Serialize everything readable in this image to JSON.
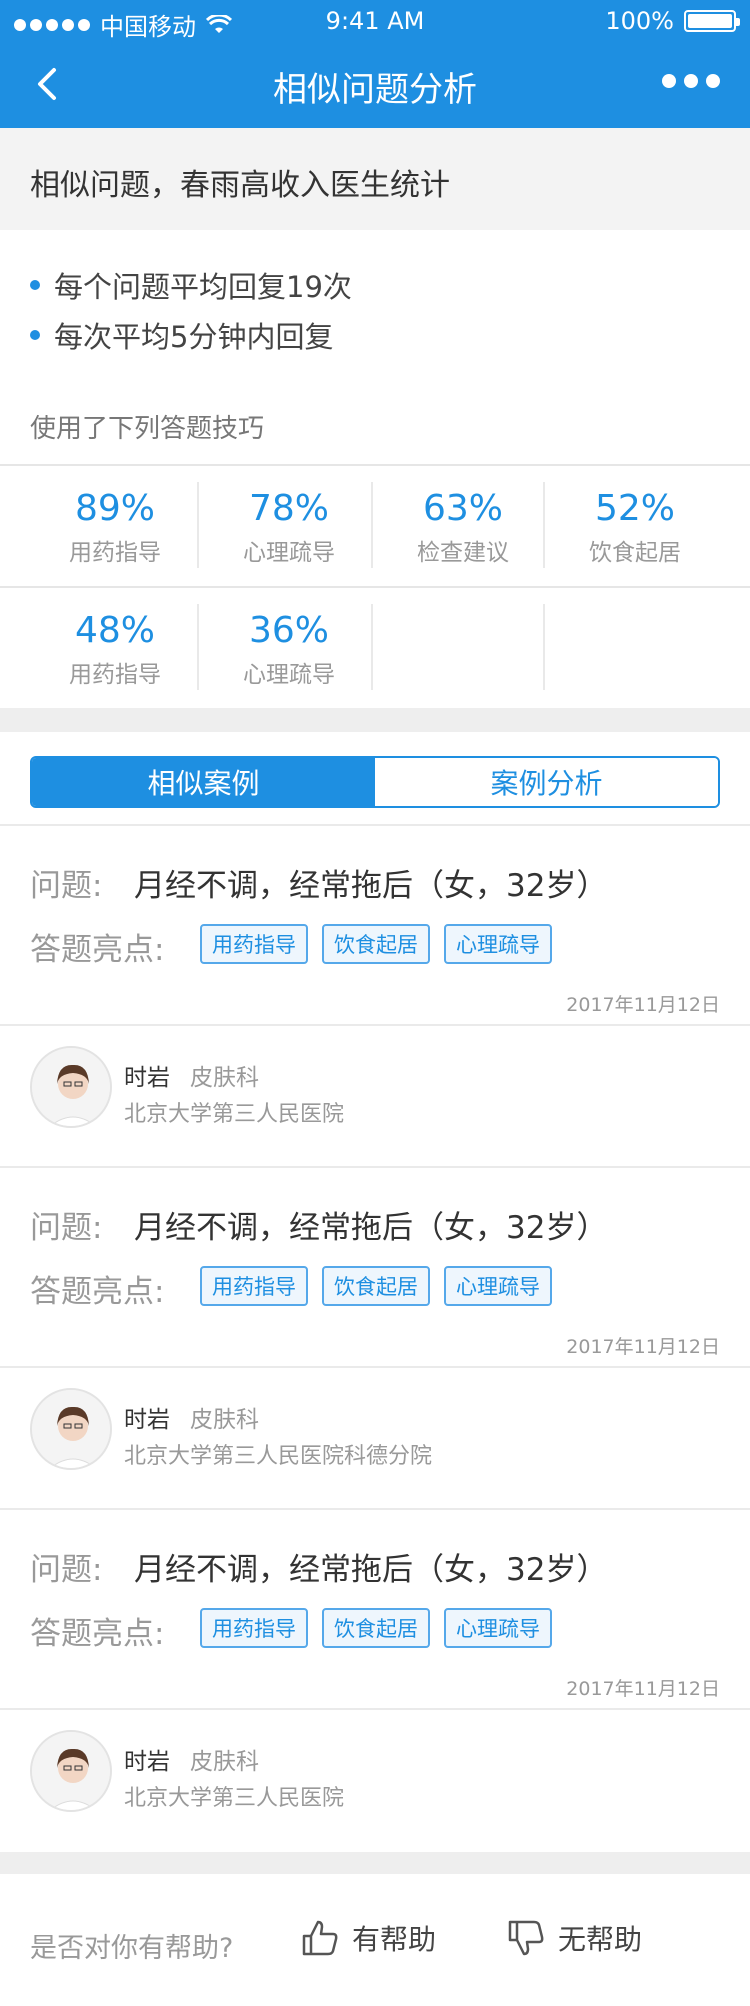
{
  "status_bar": {
    "carrier": "中国移动",
    "time": "9:41 AM",
    "battery": "100%"
  },
  "nav": {
    "title": "相似问题分析",
    "back_icon": "chevron-left-icon",
    "more_icon": "more-dots-icon"
  },
  "header": {
    "text": "相似问题，春雨高收入医生统计"
  },
  "stats": {
    "bullets": [
      "每个问题平均回复19次",
      "每次平均5分钟内回复"
    ],
    "skills_title": "使用了下列答题技巧",
    "skills": [
      {
        "pct": "89%",
        "label": "用药指导"
      },
      {
        "pct": "78%",
        "label": "心理疏导"
      },
      {
        "pct": "63%",
        "label": "检查建议"
      },
      {
        "pct": "52%",
        "label": "饮食起居"
      },
      {
        "pct": "48%",
        "label": "用药指导"
      },
      {
        "pct": "36%",
        "label": "心理疏导"
      }
    ]
  },
  "tabs": {
    "similar": "相似案例",
    "analysis": "案例分析"
  },
  "cases": [
    {
      "q_label": "问题:",
      "question": "月经不调，经常拖后（女，32岁）",
      "hl_label": "答题亮点:",
      "tags": [
        "用药指导",
        "饮食起居",
        "心理疏导"
      ],
      "date": "2017年11月12日",
      "doctor": {
        "name": "时岩",
        "dept": "皮肤科",
        "hospital": "北京大学第三人民医院"
      }
    },
    {
      "q_label": "问题:",
      "question": "月经不调，经常拖后（女，32岁）",
      "hl_label": "答题亮点:",
      "tags": [
        "用药指导",
        "饮食起居",
        "心理疏导"
      ],
      "date": "2017年11月12日",
      "doctor": {
        "name": "时岩",
        "dept": "皮肤科",
        "hospital": "北京大学第三人民医院科德分院"
      }
    },
    {
      "q_label": "问题:",
      "question": "月经不调，经常拖后（女，32岁）",
      "hl_label": "答题亮点:",
      "tags": [
        "用药指导",
        "饮食起居",
        "心理疏导"
      ],
      "date": "2017年11月12日",
      "doctor": {
        "name": "时岩",
        "dept": "皮肤科",
        "hospital": "北京大学第三人民医院"
      }
    }
  ],
  "footer": {
    "question": "是否对你有帮助?",
    "yes": "有帮助",
    "no": "无帮助"
  },
  "colors": {
    "accent": "#1E8FE1"
  }
}
